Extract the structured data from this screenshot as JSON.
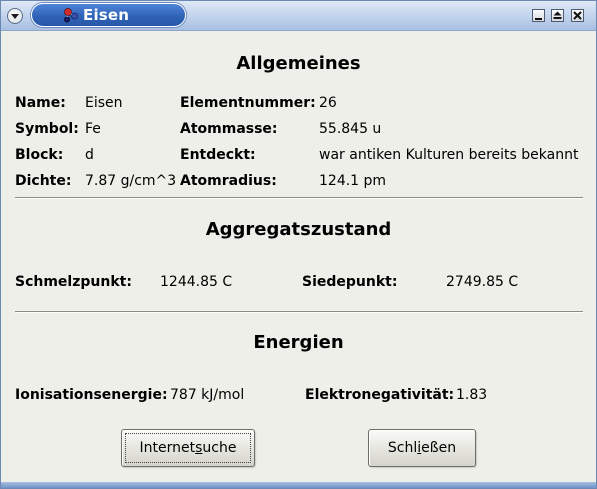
{
  "window": {
    "title": "Eisen",
    "menu_icon": "chevron-down-icon",
    "app_icon": "molecule-icon",
    "controls": [
      "minimize-icon",
      "maximize-icon",
      "close-icon"
    ]
  },
  "general": {
    "heading": "Allgemeines",
    "name_label": "Name:",
    "name_value": "Eisen",
    "symbol_label": "Symbol:",
    "symbol_value": "Fe",
    "block_label": "Block:",
    "block_value": "d",
    "density_label": "Dichte:",
    "density_value": "7.87 g/cm^3",
    "element_number_label": "Elementnummer:",
    "element_number_value": "26",
    "atomic_mass_label": "Atommasse:",
    "atomic_mass_value": "55.845 u",
    "discovered_label": "Entdeckt:",
    "discovered_value": "war antiken Kulturen bereits bekannt",
    "atomic_radius_label": "Atomradius:",
    "atomic_radius_value": "124.1 pm"
  },
  "aggregate": {
    "heading": "Aggregatszustand",
    "melting_label": "Schmelzpunkt:",
    "melting_value": "1244.85 C",
    "boiling_label": "Siedepunkt:",
    "boiling_value": "2749.85 C"
  },
  "energies": {
    "heading": "Energien",
    "ionization_label": "Ionisationsenergie:",
    "ionization_value": "787 kJ/mol",
    "electronegativity_label": "Elektronegativität:",
    "electronegativity_value": "1.83"
  },
  "buttons": {
    "internet_search_pre": "Internet",
    "internet_search_mnemonic": "s",
    "internet_search_post": "uche",
    "close_pre": "Schl",
    "close_mnemonic": "i",
    "close_post": "eßen"
  },
  "colors": {
    "title_tab": "#2e63b7",
    "window_bg": "#efefe9",
    "frame": "#6c89b3"
  }
}
